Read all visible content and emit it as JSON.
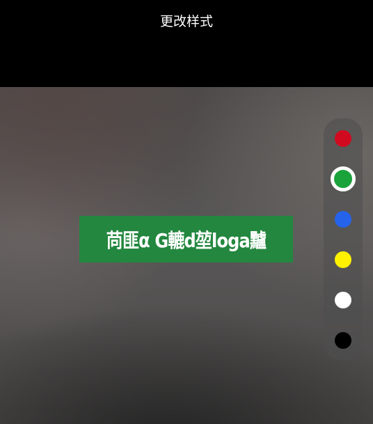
{
  "header": {
    "title": "更改样式"
  },
  "sticker": {
    "text": "苘匪α G轆d堃loga黸",
    "background_color": "#23873f",
    "text_color": "#ffffff"
  },
  "palette": {
    "selected": "green",
    "colors": [
      {
        "name": "red",
        "hex": "#d10a1f"
      },
      {
        "name": "green",
        "hex": "#1aa33b"
      },
      {
        "name": "blue",
        "hex": "#2563eb"
      },
      {
        "name": "yellow",
        "hex": "#fff200"
      },
      {
        "name": "white",
        "hex": "#ffffff"
      },
      {
        "name": "black",
        "hex": "#000000"
      }
    ]
  }
}
